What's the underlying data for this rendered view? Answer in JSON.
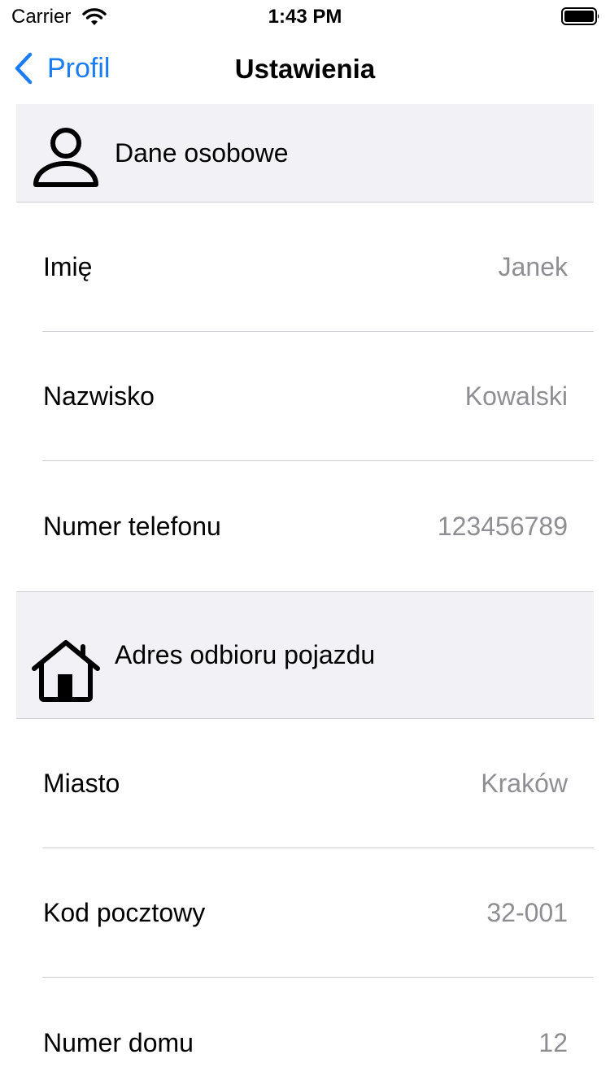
{
  "status_bar": {
    "carrier": "Carrier",
    "time": "1:43 PM"
  },
  "nav": {
    "back_label": "Profil",
    "title": "Ustawienia"
  },
  "sections": {
    "personal": {
      "title": "Dane osobowe",
      "icon": "person-icon",
      "rows": [
        {
          "label": "Imię",
          "value": "Janek"
        },
        {
          "label": "Nazwisko",
          "value": "Kowalski"
        },
        {
          "label": "Numer telefonu",
          "value": "123456789"
        }
      ]
    },
    "address": {
      "title": "Adres odbioru pojazdu",
      "icon": "house-icon",
      "rows": [
        {
          "label": "Miasto",
          "value": "Kraków"
        },
        {
          "label": "Kod pocztowy",
          "value": "32-001"
        },
        {
          "label": "Numer domu",
          "value": "12"
        }
      ]
    }
  },
  "colors": {
    "accent": "#1a7cf2",
    "header_bg": "#f1f1f6",
    "value_text": "#8e8e93",
    "separator": "#cfcfd4"
  }
}
